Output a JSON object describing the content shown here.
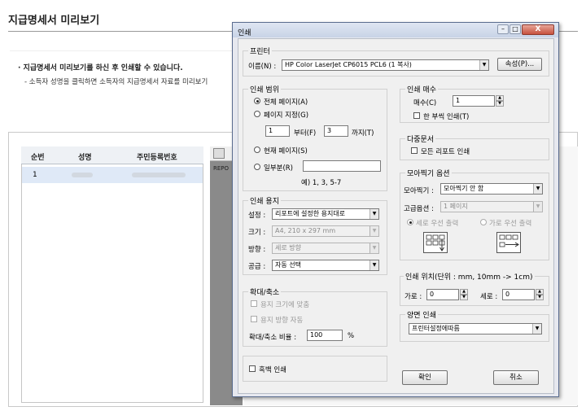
{
  "page": {
    "title": "지급명세서 미리보기",
    "info_line1": "· 지급명세서 미리보기를 하신 후 인쇄할 수 있습니다.",
    "info_line2": "- 소득자 성명을 클릭하면 소득자의 지급명세서 자료를 미리보기",
    "columns": [
      "순번",
      "성명",
      "주민등록번호"
    ],
    "rows": [
      {
        "num": "1",
        "name": "",
        "id": ""
      }
    ],
    "report_label": "REPO"
  },
  "dialog": {
    "title": "인쇄",
    "min_glyph": "–",
    "max_glyph": "□",
    "close_glyph": "X",
    "printer": {
      "group_title": "프린터",
      "name_label": "이름(N) :",
      "name_value": "HP Color LaserJet CP6015 PCL6 (1 복사)",
      "props_button": "속성(P)..."
    },
    "range": {
      "group_title": "인쇄 범위",
      "all_label": "전체 페이지(A)",
      "pages_label": "페이지 지정(G)",
      "from_value": "1",
      "from_label": "부터(F)",
      "to_value": "3",
      "to_label": "까지(T)",
      "current_label": "현재 페이지(S)",
      "part_label": "일부분(R)",
      "part_value": "",
      "example": "예) 1, 3, 5-7"
    },
    "paper": {
      "group_title": "인쇄 용지",
      "setting_label": "설정 :",
      "setting_value": "리포트에 설정한 용지대로",
      "size_label": "크기 :",
      "size_value": "A4, 210 x 297 mm",
      "orient_label": "방향 :",
      "orient_value": "세로 방향",
      "source_label": "공급 :",
      "source_value": "자동 선택"
    },
    "scale": {
      "group_title": "확대/축소",
      "fit_label": "용지 크기에 맞춤",
      "orient_auto_label": "용지 방향 자동",
      "ratio_label": "확대/축소 비율 :",
      "ratio_value": "100",
      "percent": "%"
    },
    "grayscale_label": "흑백 인쇄",
    "copies": {
      "group_title": "인쇄 매수",
      "count_label": "매수(C)",
      "count_value": "1",
      "collate_label": "한 부씩 인쇄(T)"
    },
    "multidoc": {
      "group_title": "다중문서",
      "all_reports_label": "모든 리포트 인쇄"
    },
    "nup": {
      "group_title": "모아찍기 옵션",
      "nup_label": "모아찍기 :",
      "nup_value": "모아찍기 안 함",
      "advanced_label": "고급옵션 :",
      "advanced_value": "1 페이지",
      "vertical_label": "세로 우선 출력",
      "horizontal_label": "가로 우선 출력"
    },
    "position": {
      "group_title": "인쇄 위치(단위 : mm, 10mm -> 1cm)",
      "h_label": "가로 :",
      "h_value": "0",
      "v_label": "세로 :",
      "v_value": "0"
    },
    "duplex": {
      "group_title": "양면 인쇄",
      "value": "프린터설정에따름"
    },
    "ok_button": "확인",
    "cancel_button": "취소"
  }
}
